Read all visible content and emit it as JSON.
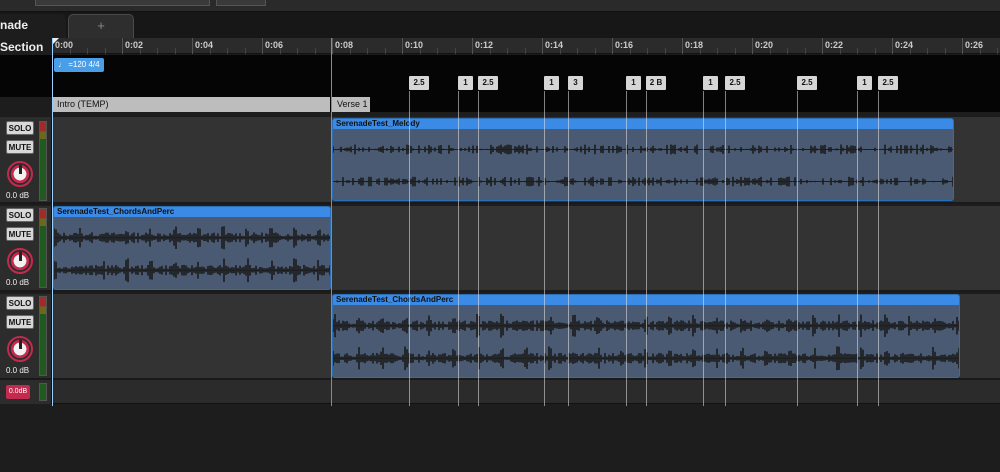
{
  "tabs": {
    "active_label": "nade Section",
    "add_label": "+"
  },
  "ruler": {
    "labels": [
      "0:00",
      "0:02",
      "0:04",
      "0:06",
      "0:08",
      "0:10",
      "0:12",
      "0:14",
      "0:16",
      "0:18",
      "0:20",
      "0:22",
      "0:24",
      "0:26"
    ]
  },
  "tempo_label": "♩ =120 4/4",
  "meter_markers": [
    "2.5",
    "1",
    "2.5",
    "1",
    "3",
    "1",
    "2 B",
    "1",
    "2.5",
    "2.5",
    "1",
    "2.5"
  ],
  "sections": [
    "Intro (TEMP)",
    "Verse 1"
  ],
  "tracks": [
    {
      "solo": "SOLO",
      "mute": "MUTE",
      "volume": "0.0 dB",
      "clips": [
        {
          "name": "SerenadeTest_Melody"
        }
      ]
    },
    {
      "solo": "SOLO",
      "mute": "MUTE",
      "volume": "0.0 dB",
      "clips": [
        {
          "name": "SerenadeTest_ChordsAndPerc"
        }
      ]
    },
    {
      "solo": "SOLO",
      "mute": "MUTE",
      "volume": "0.0 dB",
      "clips": [
        {
          "name": "SerenadeTest_ChordsAndPerc"
        }
      ]
    }
  ],
  "master": {
    "volume_label": "0.0dB"
  },
  "colors": {
    "clip_header": "#3a8ae6",
    "clip_body": "#4b5a73",
    "knob_ring": "#c32a4d",
    "tempo_flag": "#4a9ee8",
    "section_header": "#bdbdbd"
  }
}
